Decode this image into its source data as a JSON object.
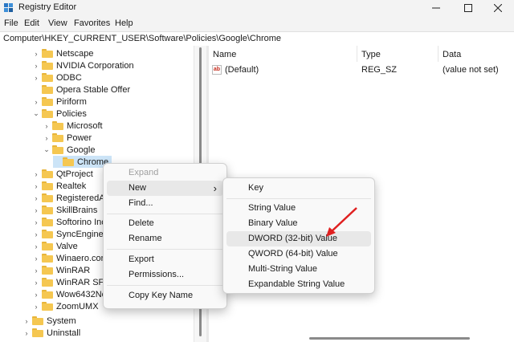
{
  "window": {
    "title": "Registry Editor"
  },
  "menu": [
    "File",
    "Edit",
    "View",
    "Favorites",
    "Help"
  ],
  "address": "Computer\\HKEY_CURRENT_USER\\Software\\Policies\\Google\\Chrome",
  "tree": [
    {
      "label": "Netscape",
      "expander": "›"
    },
    {
      "label": "NVIDIA Corporation",
      "expander": "›"
    },
    {
      "label": "ODBC",
      "expander": "›"
    },
    {
      "label": "Opera Stable Offer",
      "expander": ""
    },
    {
      "label": "Piriform",
      "expander": "›"
    },
    {
      "label": "Policies",
      "expander": "⌄"
    },
    {
      "label": "Microsoft",
      "expander": "›"
    },
    {
      "label": "Power",
      "expander": "›"
    },
    {
      "label": "Google",
      "expander": "⌄"
    },
    {
      "label": "Chrome",
      "expander": "",
      "selected": true
    },
    {
      "label": "QtProject",
      "expander": "›"
    },
    {
      "label": "Realtek",
      "expander": "›"
    },
    {
      "label": "RegisteredA",
      "expander": "›"
    },
    {
      "label": "SkillBrains",
      "expander": "›"
    },
    {
      "label": "Softorino Inc",
      "expander": "›"
    },
    {
      "label": "SyncEngines",
      "expander": "›"
    },
    {
      "label": "Valve",
      "expander": "›"
    },
    {
      "label": "Winaero.cor",
      "expander": "›"
    },
    {
      "label": "WinRAR",
      "expander": "›"
    },
    {
      "label": "WinRAR SFX",
      "expander": "›"
    },
    {
      "label": "Wow6432Nc",
      "expander": "›"
    },
    {
      "label": "ZoomUMX",
      "expander": "›"
    },
    {
      "label": "System",
      "expander": "›"
    },
    {
      "label": "Uninstall",
      "expander": "›"
    }
  ],
  "columns": {
    "name": "Name",
    "type": "Type",
    "data": "Data"
  },
  "values": [
    {
      "name": "(Default)",
      "type": "REG_SZ",
      "data": "(value not set)",
      "icon": "ab"
    }
  ],
  "context_menu": {
    "items": [
      "Expand",
      "New",
      "Find...",
      "Delete",
      "Rename",
      "Export",
      "Permissions...",
      "Copy Key Name"
    ],
    "disabled": [
      "Expand"
    ],
    "hovered": "New",
    "submenu_arrow": "›"
  },
  "submenu": {
    "items": [
      "Key",
      "String Value",
      "Binary Value",
      "DWORD (32-bit) Value",
      "QWORD (64-bit) Value",
      "Multi-String Value",
      "Expandable String Value"
    ],
    "hovered": "DWORD (32-bit) Value"
  },
  "colors": {
    "annotation_arrow": "#e02020",
    "selection": "#cce4f7",
    "folder": "#f5c751"
  }
}
